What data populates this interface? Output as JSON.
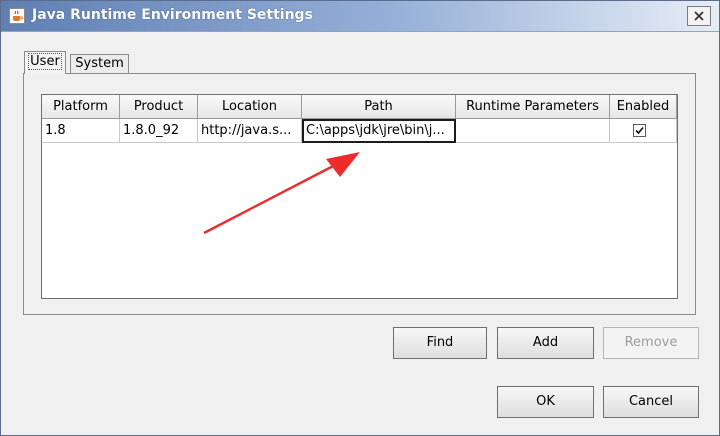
{
  "window": {
    "title": "Java Runtime Environment Settings"
  },
  "tabs": [
    {
      "label": "User",
      "selected": true
    },
    {
      "label": "System",
      "selected": false
    }
  ],
  "table": {
    "columns": [
      "Platform",
      "Product",
      "Location",
      "Path",
      "Runtime Parameters",
      "Enabled"
    ],
    "rows": [
      {
        "platform": "1.8",
        "product": "1.8.0_92",
        "location": "http://java.s...",
        "path": "C:\\apps\\jdk\\jre\\bin\\j...",
        "runtime_parameters": "",
        "enabled": true
      }
    ]
  },
  "buttons": {
    "find": "Find",
    "add": "Add",
    "remove": "Remove",
    "ok": "OK",
    "cancel": "Cancel"
  },
  "annotation": {
    "arrow_color": "#ee2b2b"
  },
  "colors": {
    "titlebar_start": "#5f7fb3",
    "titlebar_end": "#e7edf6"
  }
}
